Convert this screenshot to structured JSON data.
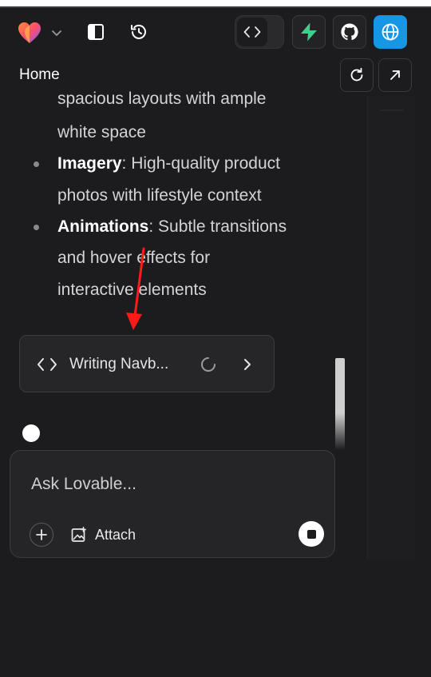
{
  "header": {
    "home_label": "Home"
  },
  "content": {
    "lines": [
      "spacious layouts with ample",
      "white space",
      "photos with lifestyle context",
      "and hover effects for",
      "interactive elements"
    ],
    "bullets": [
      {
        "term": "Imagery",
        "rest": ": High-quality product"
      },
      {
        "term": "Animations",
        "rest": ": Subtle transitions"
      }
    ]
  },
  "task_card": {
    "label": "Writing Navb..."
  },
  "composer": {
    "placeholder": "Ask Lovable...",
    "attach_label": "Attach"
  },
  "colors": {
    "background": "#1c1c1e",
    "accent_blue": "#1597e6",
    "supabase_green": "#3ecf8e",
    "arrow_red": "#ff1a1a"
  },
  "icons": [
    "lovable-heart-icon",
    "chevron-down-icon",
    "sidebar-toggle-icon",
    "history-icon",
    "code-icon",
    "supabase-icon",
    "github-icon",
    "globe-icon",
    "refresh-icon",
    "external-link-icon",
    "spinner-icon",
    "chevron-right-icon",
    "plus-icon",
    "image-icon",
    "stop-icon"
  ]
}
